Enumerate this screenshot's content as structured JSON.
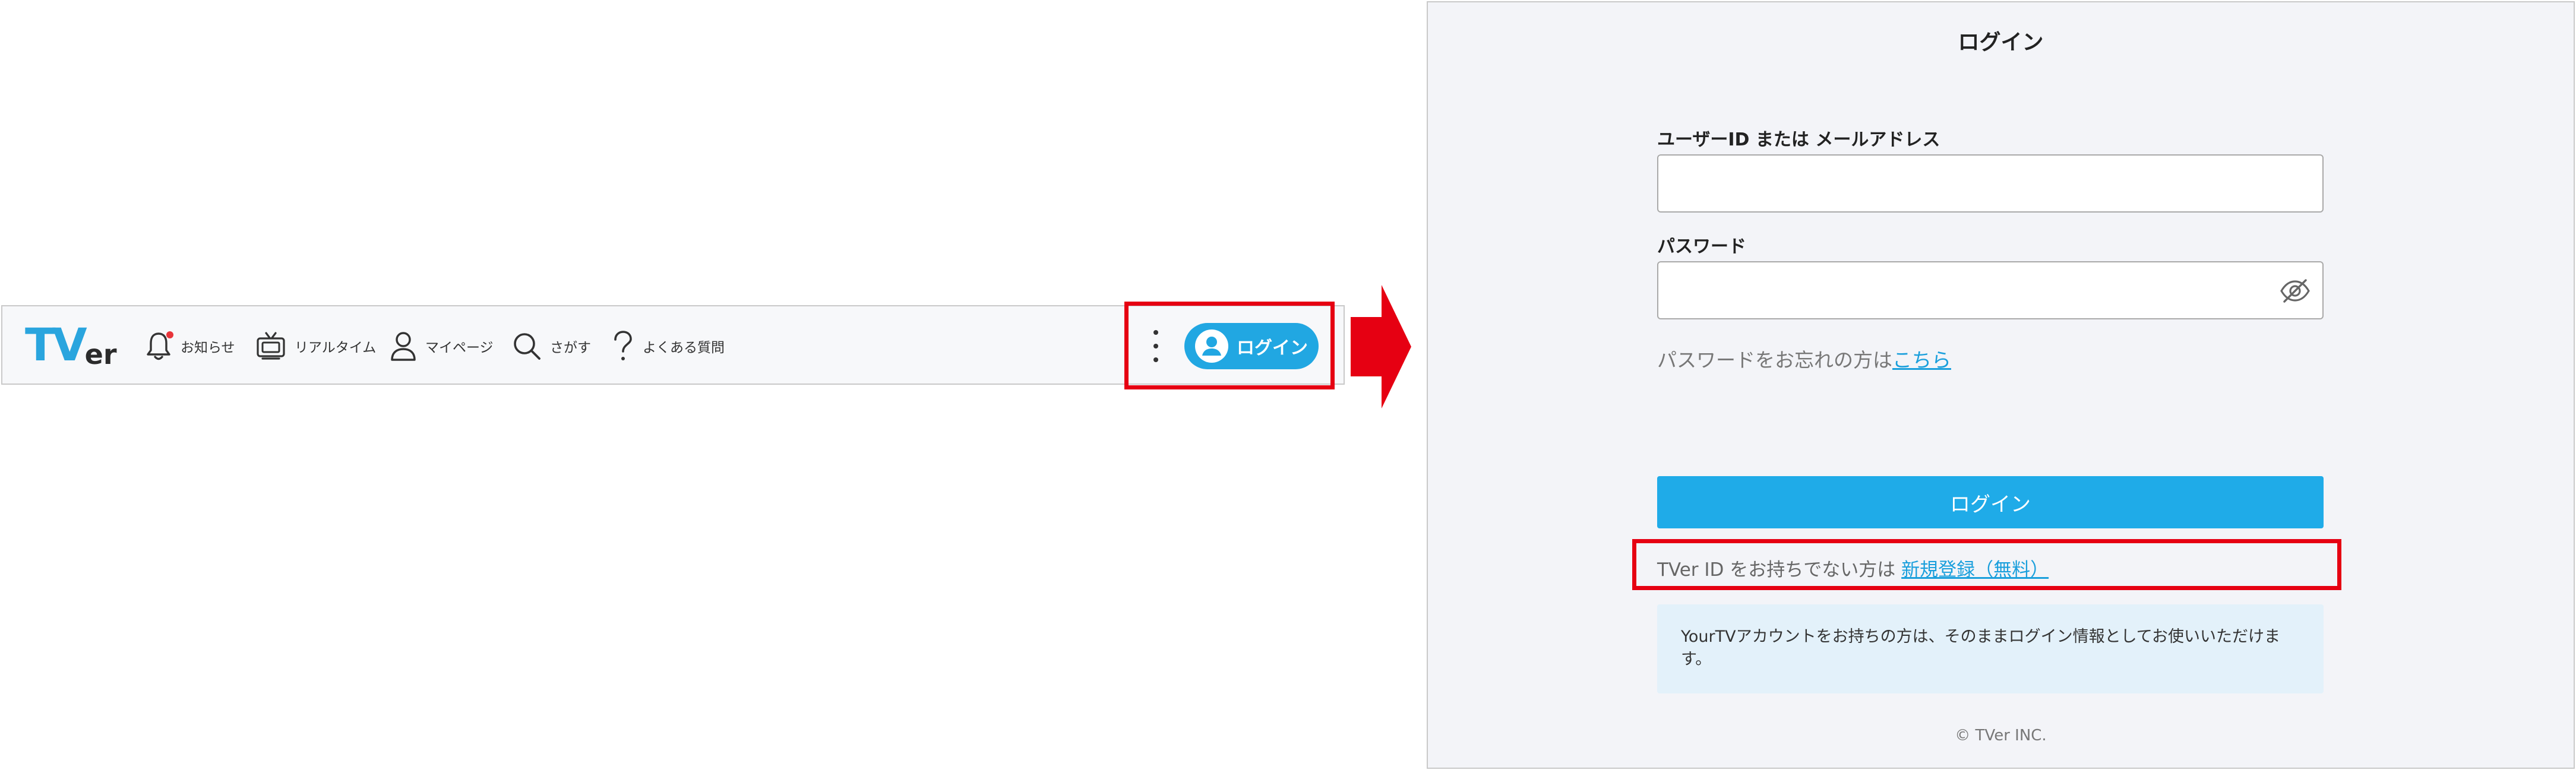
{
  "header": {
    "logo_t": "TV",
    "logo_er": "er",
    "nav": [
      {
        "label": "お知らせ",
        "icon": "bell-icon"
      },
      {
        "label": "リアルタイム",
        "icon": "tv-icon"
      },
      {
        "label": "マイページ",
        "icon": "user-icon"
      },
      {
        "label": "さがす",
        "icon": "search-icon"
      },
      {
        "label": "よくある質問",
        "icon": "question-icon"
      }
    ],
    "menu_icon": "kebab-menu-icon",
    "login_button": "ログイン",
    "colors": {
      "accent": "#21a7e2",
      "notification_dot": "#e8343a"
    }
  },
  "annotations": {
    "highlight_color": "#e60012",
    "arrow_color": "#e60012"
  },
  "login": {
    "title": "ログイン",
    "userid_label": "ユーザーID または メールアドレス",
    "userid_value": "",
    "password_label": "パスワード",
    "password_value": "",
    "password_toggle_icon": "eye-off-icon",
    "forgot_text": "パスワードをお忘れの方は",
    "forgot_link": "こちら",
    "submit_label": "ログイン",
    "register_text": "TVer ID をお持ちでない方は ",
    "register_link": "新規登録（無料）",
    "notice": "YourTVアカウントをお持ちの方は、そのままログイン情報としてお使いいただけます。",
    "copyright": "© TVer INC.",
    "colors": {
      "button": "#1fabe8",
      "link": "#1a9fdc",
      "notice_bg": "#e3f1fa"
    }
  }
}
